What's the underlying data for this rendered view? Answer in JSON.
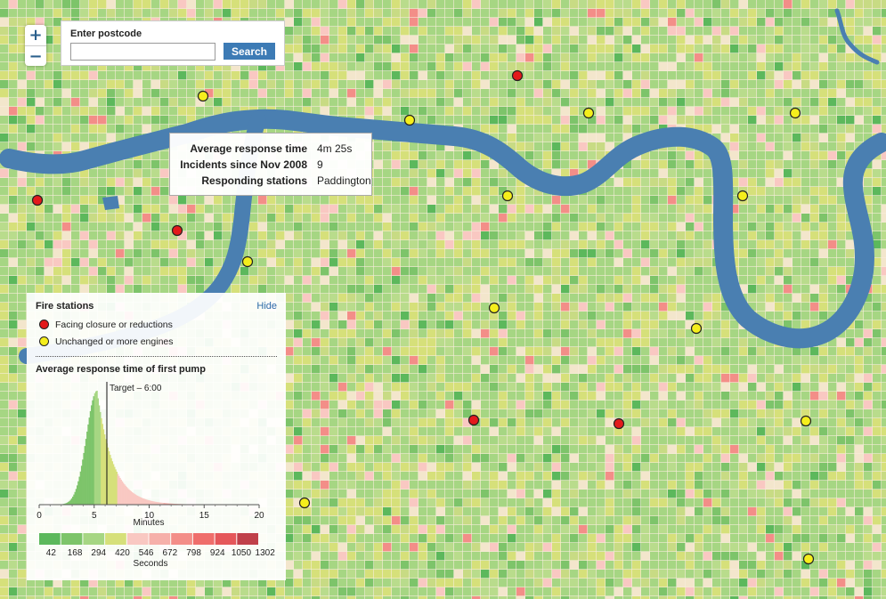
{
  "zoom": {
    "in_label": "+",
    "out_label": "−"
  },
  "search": {
    "label": "Enter postcode",
    "placeholder": "",
    "value": "",
    "button": "Search"
  },
  "tooltip": {
    "rows": [
      {
        "key": "Average response time",
        "value": "4m 25s"
      },
      {
        "key": "Incidents since Nov 2008",
        "value": "9"
      },
      {
        "key": "Responding stations",
        "value": "Paddington"
      }
    ]
  },
  "legend": {
    "title": "Fire stations",
    "hide": "Hide",
    "keys": [
      {
        "label": "Facing closure or reductions",
        "color": "#e31a1c"
      },
      {
        "label": "Unchanged or more engines",
        "color": "#f5ee1c"
      }
    ],
    "histogram_title": "Average response time of first pump",
    "target_label": "Target – 6:00",
    "minutes_label": "Minutes",
    "seconds_label": "Seconds",
    "minute_ticks": [
      "0",
      "5",
      "10",
      "15",
      "20"
    ],
    "seconds_ticks": [
      "42",
      "168",
      "294",
      "420",
      "546",
      "672",
      "798",
      "924",
      "1050",
      "1302"
    ],
    "scale_colors": [
      "#5cb85c",
      "#7dc46a",
      "#a6d683",
      "#d6e07a",
      "#f9c8c2",
      "#f6b0aa",
      "#f38e88",
      "#ef6e6b",
      "#e5575a",
      "#c0404a"
    ]
  },
  "colors": {
    "river": "#4a7fb1",
    "land": "#f8eddc",
    "closure": "#e31a1c",
    "unchanged": "#f5ee1c"
  },
  "stations": {
    "closure": 5,
    "unchanged": 13
  }
}
